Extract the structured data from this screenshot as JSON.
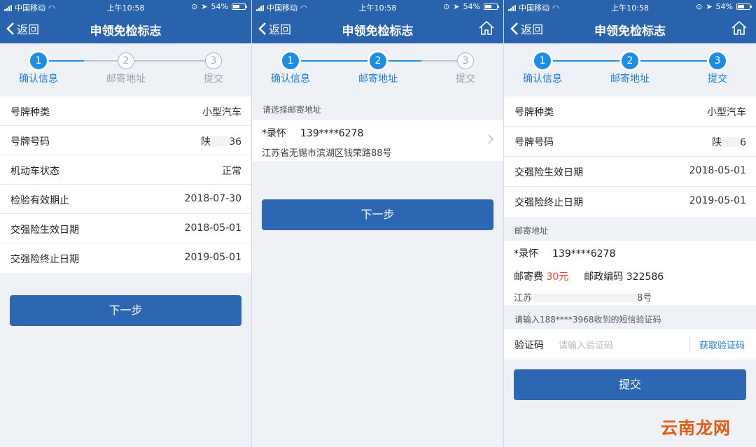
{
  "status": {
    "carrier": "中国移动",
    "time": "上午10:58",
    "battery": "54%"
  },
  "nav": {
    "back": "返回",
    "title": "申领免检标志"
  },
  "steps": [
    "确认信息",
    "邮寄地址",
    "提交"
  ],
  "step_numbers": [
    "1",
    "2",
    "3"
  ],
  "screen1": {
    "rows": [
      {
        "label": "号牌种类",
        "value": "小型汽车"
      },
      {
        "label": "号牌号码",
        "value_prefix": "陕",
        "value_suffix": "36"
      },
      {
        "label": "机动车状态",
        "value": "正常"
      },
      {
        "label": "检验有效期止",
        "value": "2018-07-30"
      },
      {
        "label": "交强险生效日期",
        "value": "2018-05-01"
      },
      {
        "label": "交强险终止日期",
        "value": "2019-05-01"
      }
    ],
    "next": "下一步"
  },
  "screen2": {
    "hint": "请选择邮寄地址",
    "name": "*录怀",
    "phone": "139****6278",
    "address": "江苏省无锡市滨湖区钱荣路88号",
    "next": "下一步"
  },
  "screen3": {
    "rows": [
      {
        "label": "号牌种类",
        "value": "小型汽车"
      },
      {
        "label": "号牌号码",
        "value_prefix": "陕",
        "value_suffix": "6"
      },
      {
        "label": "交强险生效日期",
        "value": "2018-05-01"
      },
      {
        "label": "交强险终止日期",
        "value": "2019-05-01"
      }
    ],
    "mail_header": "邮寄地址",
    "name": "*录怀",
    "phone": "139****6278",
    "fee_label": "邮寄费",
    "fee_value": "30元",
    "postcode_label": "邮政编码",
    "postcode": "322586",
    "address_prefix": "江苏",
    "address_suffix": "8号",
    "sms_hint": "请输入188****3968收到的短信验证码",
    "code_label": "验证码",
    "code_placeholder": "请输入验证码",
    "get_code": "获取验证码",
    "submit": "提交"
  },
  "watermark": "云南龙网",
  "colors": {
    "nav": "#2a63ad",
    "step_active": "#1d8ee6",
    "button": "#2d66b3",
    "fee": "#e8412b"
  }
}
